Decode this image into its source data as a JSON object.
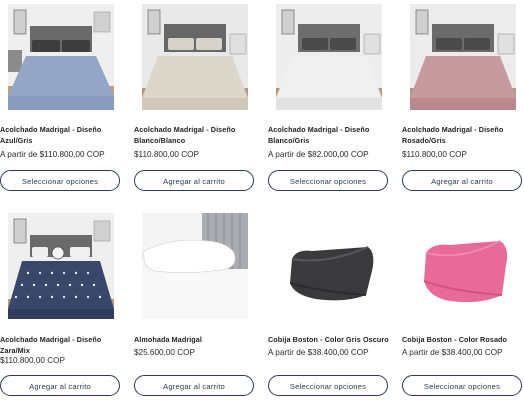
{
  "products": [
    {
      "name": "Acolchado Madrigal - Diseño Azul/Gris",
      "price": "A partir de $110.800,00 COP",
      "button": "Seleccionar opciones",
      "image": "blue-gray-bedspread",
      "color": "#93a6c6"
    },
    {
      "name": "Acolchado Madrigal - Diseño Blanco/Blanco",
      "price": "$110.800,00 COP",
      "button": "Agregar al carrito",
      "image": "white-bedspread",
      "color": "#ddd6cb"
    },
    {
      "name": "Acolchado Madrigal - Diseño Blanco/Gris",
      "price": "A partir de $82.000,00 COP",
      "button": "Seleccionar opciones",
      "image": "white-gray-bedspread",
      "color": "#e6e6e6"
    },
    {
      "name": "Acolchado Madrigal - Diseño Rosado/Gris",
      "price": "$110.800,00 COP",
      "button": "Agregar al carrito",
      "image": "pink-gray-bedspread",
      "color": "#c79a9f"
    },
    {
      "name": "Acolchado Madrigal - Diseño Zara/Mix",
      "price": "$110.800,00 COP",
      "button": "Agregar al carrito",
      "image": "zara-mix-bedspread",
      "color": "#38476a"
    },
    {
      "name": "Almohada Madrigal",
      "price": "$25.600,00 COP",
      "button": "Agregar al carrito",
      "image": "pillow",
      "color": "#ffffff"
    },
    {
      "name": "Cobija Boston - Color Gris Oscuro",
      "price": "A partir de $38.400,00 COP",
      "button": "Seleccionar opciones",
      "image": "dark-gray-blanket",
      "color": "#3a3a3c"
    },
    {
      "name": "Cobija Boston - Color Rosado",
      "price": "A partir de $38.400,00 COP",
      "button": "Seleccionar opciones",
      "image": "pink-blanket",
      "color": "#e76a99"
    }
  ]
}
